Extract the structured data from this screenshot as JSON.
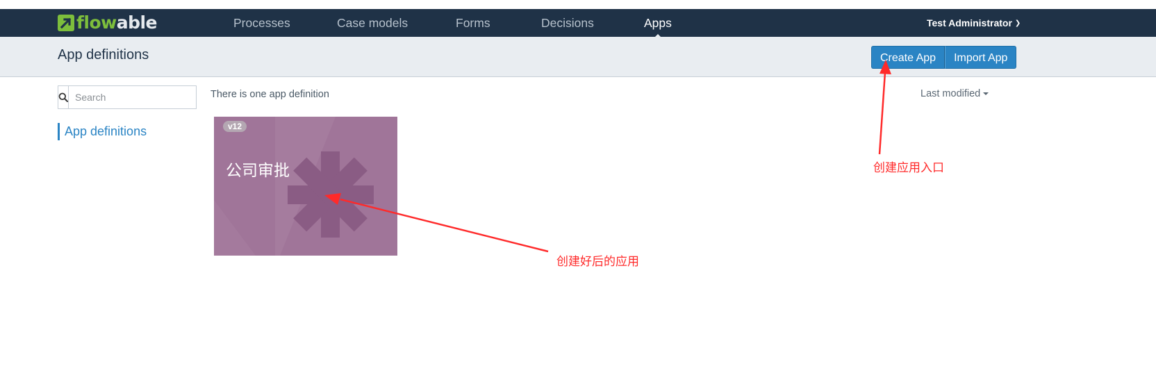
{
  "navbar": {
    "brand": {
      "part1": "flow",
      "part2": "able"
    },
    "items": [
      {
        "label": "Processes",
        "active": false
      },
      {
        "label": "Case models",
        "active": false
      },
      {
        "label": "Forms",
        "active": false
      },
      {
        "label": "Decisions",
        "active": false
      },
      {
        "label": "Apps",
        "active": true
      }
    ],
    "user": "Test Administrator"
  },
  "subheader": {
    "title": "App definitions",
    "buttons": {
      "create": "Create App",
      "import": "Import App"
    }
  },
  "sidebar": {
    "search": {
      "placeholder": "Search",
      "value": ""
    },
    "link": "App definitions"
  },
  "main": {
    "count_text": "There is one app definition",
    "sort_label": "Last modified",
    "apps": [
      {
        "version": "v12",
        "name": "公司审批",
        "color": "#a07599",
        "icon": "asterisk-icon"
      }
    ]
  },
  "annotations": {
    "create_entry": "创建应用入口",
    "created_app": "创建好后的应用",
    "color": "#ff2a2a"
  },
  "colors": {
    "navbar_bg": "#1f3247",
    "subheader_bg": "#e9edf1",
    "primary_button": "#2a84c4",
    "brand_green": "#7dbe3c"
  }
}
